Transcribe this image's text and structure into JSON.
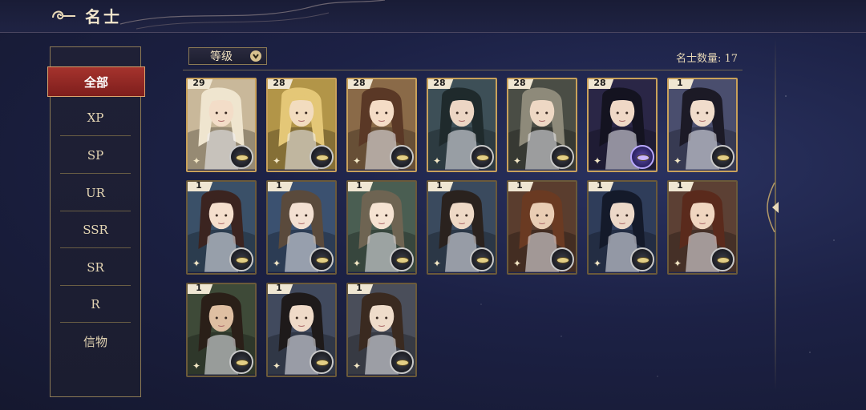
{
  "header": {
    "title": "名士",
    "logo_icon": "cloud-swirl-icon"
  },
  "sidebar": {
    "items": [
      {
        "label": "全部",
        "active": true
      },
      {
        "label": "XP"
      },
      {
        "label": "SP"
      },
      {
        "label": "UR"
      },
      {
        "label": "SSR"
      },
      {
        "label": "SR"
      },
      {
        "label": "R"
      },
      {
        "label": "信物"
      }
    ]
  },
  "filter": {
    "label": "等级",
    "icon": "chevron-down-icon"
  },
  "count": {
    "text": "名士数量: 17"
  },
  "cards": [
    {
      "level": "29",
      "bg": "#c9b89a",
      "hair": "#efe5cf",
      "skin": "#f3ddc8",
      "badge": "normal",
      "frame": "gold"
    },
    {
      "level": "28",
      "bg": "#b29548",
      "hair": "#e4c777",
      "skin": "#f2dcbf",
      "badge": "normal",
      "frame": "gold"
    },
    {
      "level": "28",
      "bg": "#8a6a48",
      "hair": "#5a3826",
      "skin": "#f4dcc6",
      "badge": "normal",
      "frame": "gold"
    },
    {
      "level": "28",
      "bg": "#3d4f57",
      "hair": "#1f2a2c",
      "skin": "#ecd6c4",
      "badge": "normal",
      "frame": "gold"
    },
    {
      "level": "28",
      "bg": "#4a4d45",
      "hair": "#8e8a7a",
      "skin": "#eed8c4",
      "badge": "normal",
      "frame": "gold"
    },
    {
      "level": "28",
      "bg": "#2a2646",
      "hair": "#141320",
      "skin": "#efd8c6",
      "badge": "purple",
      "frame": "gold"
    },
    {
      "level": "1",
      "bg": "#4a4e6e",
      "hair": "#1c1a26",
      "skin": "#f0dccb",
      "badge": "normal",
      "frame": "gold"
    },
    {
      "level": "1",
      "bg": "#3a5068",
      "hair": "#3b2420",
      "skin": "#f5dfcd",
      "badge": "normal",
      "frame": "plain"
    },
    {
      "level": "1",
      "bg": "#3b5170",
      "hair": "#5a4a3c",
      "skin": "#f3e0d2",
      "badge": "normal",
      "frame": "plain"
    },
    {
      "level": "1",
      "bg": "#4a5e52",
      "hair": "#6e6452",
      "skin": "#f5e3d2",
      "badge": "normal",
      "frame": "plain"
    },
    {
      "level": "1",
      "bg": "#3a4a5e",
      "hair": "#2a221e",
      "skin": "#eed9c6",
      "badge": "normal",
      "frame": "plain"
    },
    {
      "level": "1",
      "bg": "#5a3d2e",
      "hair": "#6a3a22",
      "skin": "#e9cdb4",
      "badge": "normal",
      "frame": "plain"
    },
    {
      "level": "1",
      "bg": "#2f3d5a",
      "hair": "#141a2a",
      "skin": "#ecd8c8",
      "badge": "normal",
      "frame": "plain"
    },
    {
      "level": "1",
      "bg": "#5c4034",
      "hair": "#5a2a1c",
      "skin": "#f0d6c0",
      "badge": "normal",
      "frame": "plain"
    },
    {
      "level": "1",
      "bg": "#3e4a38",
      "hair": "#2a1f18",
      "skin": "#dfbfa2",
      "badge": "normal",
      "frame": "plain"
    },
    {
      "level": "1",
      "bg": "#414a5e",
      "hair": "#1e1a1a",
      "skin": "#efdac8",
      "badge": "normal",
      "frame": "plain"
    },
    {
      "level": "1",
      "bg": "#4a4e5a",
      "hair": "#3a2a20",
      "skin": "#efdcca",
      "badge": "normal",
      "frame": "plain"
    }
  ]
}
